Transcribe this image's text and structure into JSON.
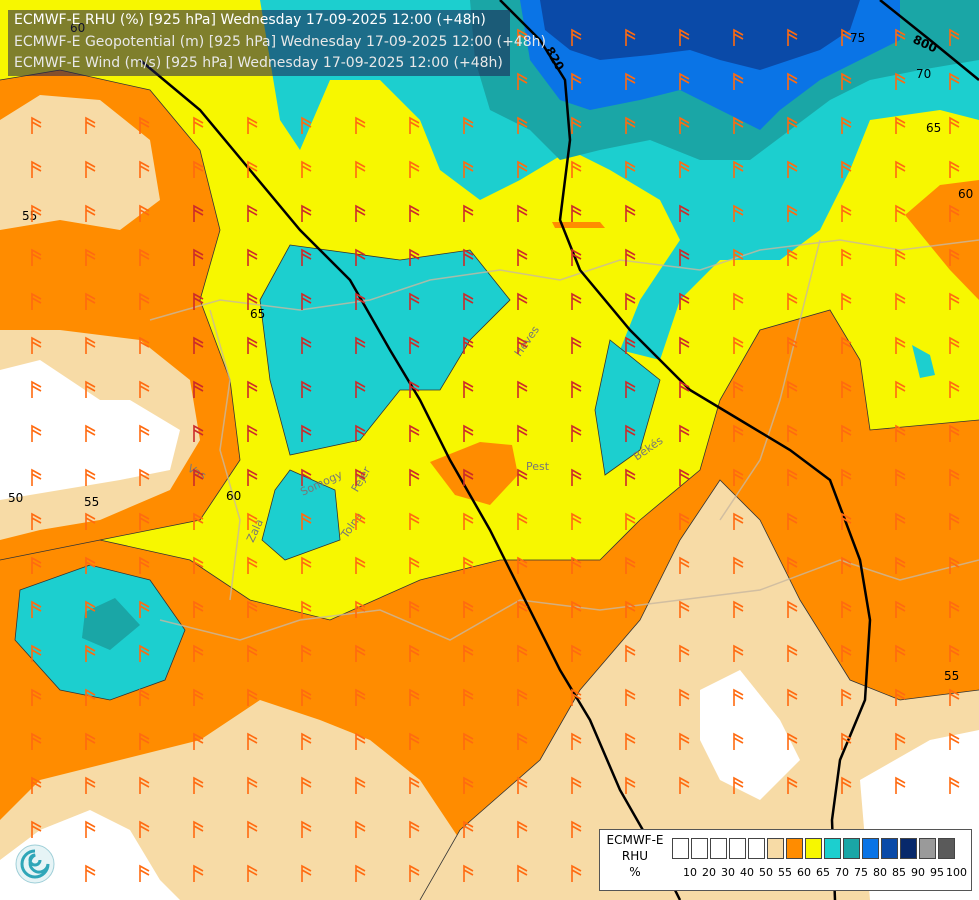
{
  "titles": {
    "line1": "ECMWF-E RHU (%) [925 hPa] Wednesday 17-09-2025 12:00 (+48h)",
    "line2": "ECMWF-E Geopotential (m) [925 hPa] Wednesday 17-09-2025 12:00 (+48h)",
    "line3": "ECMWF-E Wind (m/s) [925 hPa] Wednesday 17-09-2025 12:00 (+48h)"
  },
  "contour_labels": {
    "geo_820": "820",
    "geo_800": "800",
    "rhu_50_top": "60",
    "rhu_75": "75",
    "rhu_70": "70",
    "rhu_65": "65",
    "rhu_60_right": "60",
    "rhu_55_left": "55",
    "rhu_65_mid": "65",
    "rhu_60_mid": "60",
    "rhu_55_mid": "55",
    "rhu_50_left": "50",
    "rhu_55_right": "55"
  },
  "place_labels": {
    "heves": "Heves",
    "pest": "Pest",
    "bekes": "Békés",
    "fejer": "Fejér",
    "somogy": "Somogy",
    "tolna": "Tolna",
    "zala": "Zala",
    "vas": "Vas"
  },
  "legend": {
    "name_line1": "ECMWF-E",
    "name_line2": "RHU",
    "name_line3": "%",
    "swatches": [
      "#ffffff",
      "#ffffff",
      "#ffffff",
      "#ffffff",
      "#ffffff",
      "#f7dba6",
      "#ff8c00",
      "#f7f700",
      "#1ccfcf",
      "#1aa6a6",
      "#0a74e6",
      "#0a4aa8",
      "#08296b",
      "#9a9a9a",
      "#5a5a5a"
    ],
    "ticks": [
      "10",
      "20",
      "30",
      "40",
      "50",
      "55",
      "60",
      "65",
      "70",
      "75",
      "80",
      "85",
      "90",
      "95",
      "100"
    ]
  },
  "colors": {
    "white": "#ffffff",
    "tan": "#f7dba6",
    "orange": "#ff8c00",
    "yellow": "#f7f700",
    "cyan": "#1ccfcf",
    "teal": "#1aa6a6",
    "blue": "#0a74e6",
    "darkblue": "#0a4aa8"
  },
  "logo_icon": "ecmwf-swirl-icon"
}
